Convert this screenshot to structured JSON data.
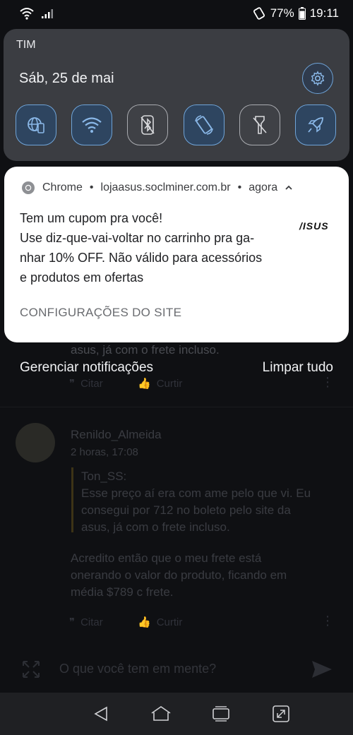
{
  "status_bar": {
    "battery_percent": "77%",
    "time": "19:11"
  },
  "quick_settings": {
    "carrier": "TIM",
    "date": "Sáb, 25 de mai",
    "tiles": [
      {
        "name": "data-saver",
        "active": true
      },
      {
        "name": "wifi",
        "active": true
      },
      {
        "name": "bluetooth-off",
        "active": false
      },
      {
        "name": "auto-rotate",
        "active": true
      },
      {
        "name": "flashlight-off",
        "active": false
      },
      {
        "name": "game-boost",
        "active": true
      }
    ]
  },
  "notification": {
    "app": "Chrome",
    "source": "lojaasus.soclminer.com.br",
    "time": "agora",
    "header_sep": "•",
    "line1": "Tem um cupom pra você!",
    "line2": "Use diz-que-vai-voltar no carrinho pra ga-",
    "line3": "nhar 10% OFF. Não válido para acessórios",
    "line4": "e produtos em ofertas",
    "logo_text": "/ISUS",
    "action": "CONFIGURAÇÕES DO SITE"
  },
  "notification_footer": {
    "manage": "Gerenciar notificações",
    "clear": "Limpar tudo"
  },
  "background_forum": {
    "quote_tail": "asus, já com o frete incluso.",
    "cite_label": "Citar",
    "like_label": "Curtir",
    "author": "Renildo_Almeida",
    "time": "2 horas, 17:08",
    "quoted_author": "Ton_SS:",
    "quote_l1": "Esse preço aí era com ame pelo que vi. Eu",
    "quote_l2": "consegui por 712 no boleto pelo site da",
    "quote_l3": "asus, já com o frete incluso.",
    "reply_l1": "Acredito então que o meu frete está",
    "reply_l2": "onerando o valor do produto, ficando em",
    "reply_l3": "média $789 c frete.",
    "input_placeholder": "O que você tem em mente?"
  }
}
